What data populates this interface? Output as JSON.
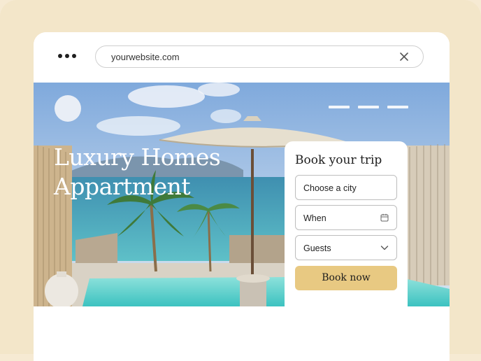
{
  "browser": {
    "url": "yourwebsite.com",
    "menu_icon": "more-dots-icon",
    "close_icon": "close-icon"
  },
  "hero": {
    "title_line1": "Luxury Homes",
    "title_line2": "Appartment",
    "nav_icon": "hamburger-menu-icon"
  },
  "booking": {
    "title": "Book your trip",
    "city_placeholder": "Choose a city",
    "date_placeholder": "When",
    "date_icon": "calendar-icon",
    "guests_label": "Guests",
    "guests_icon": "chevron-down-icon",
    "button_label": "Book now"
  },
  "colors": {
    "page_background": "#f3e6c9",
    "accent_button": "#e8c982",
    "card_background": "#ffffff"
  }
}
